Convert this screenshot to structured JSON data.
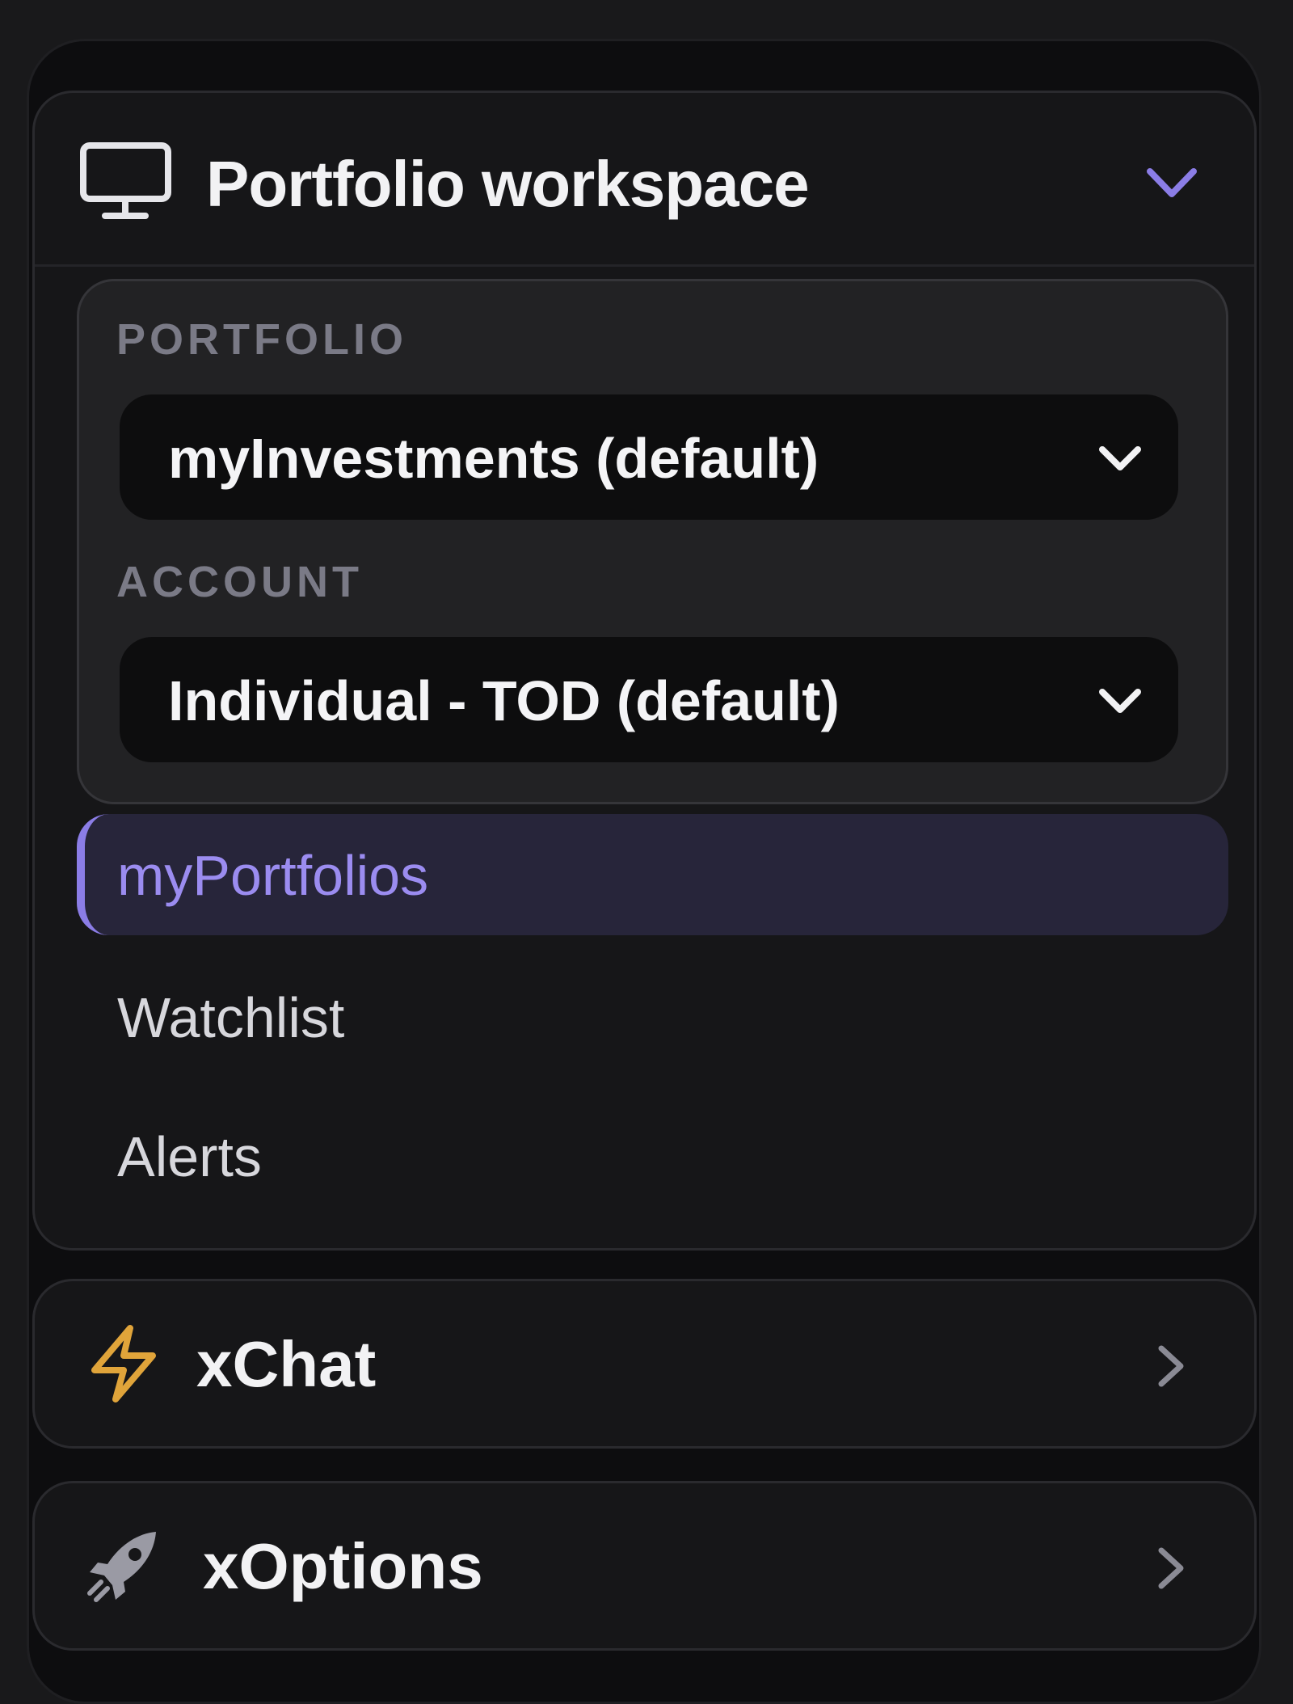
{
  "workspace": {
    "title": "Portfolio workspace",
    "icon": "monitor-icon",
    "expanded": true,
    "portfolio": {
      "label": "PORTFOLIO",
      "selected": "myInvestments (default)"
    },
    "account": {
      "label": "ACCOUNT",
      "selected": "Individual - TOD (default)"
    },
    "nav": [
      {
        "label": "myPortfolios",
        "active": true
      },
      {
        "label": "Watchlist",
        "active": false
      },
      {
        "label": "Alerts",
        "active": false
      }
    ]
  },
  "sections": [
    {
      "title": "xChat",
      "icon": "lightning-icon",
      "expanded": false
    },
    {
      "title": "xOptions",
      "icon": "rocket-icon",
      "expanded": false
    }
  ],
  "colors": {
    "accent": "#8b7de6",
    "active_bg": "#27253a",
    "lightning": "#e0a43a",
    "background": "#19191b",
    "card": "#161618"
  }
}
